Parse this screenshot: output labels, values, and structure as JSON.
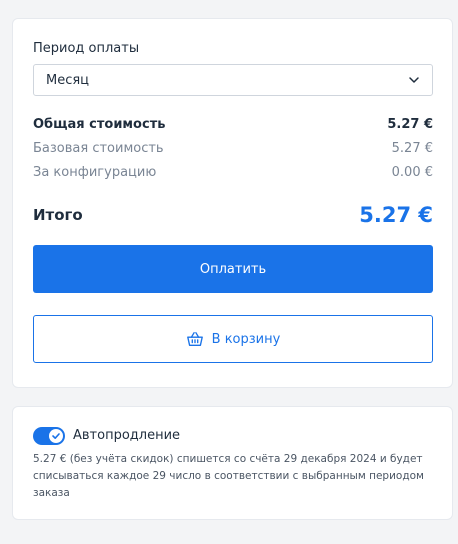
{
  "payment": {
    "period_label": "Период оплаты",
    "period_value": "Месяц",
    "total_cost_label": "Общая стоимость",
    "total_cost_value": "5.27 €",
    "base_cost_label": "Базовая стоимость",
    "base_cost_value": "5.27 €",
    "config_label": "За конфигурацию",
    "config_value": "0.00 €",
    "grand_total_label": "Итого",
    "grand_total_value": "5.27 €",
    "pay_button": "Оплатить",
    "cart_button": "В корзину"
  },
  "autorenew": {
    "enabled": true,
    "label": "Автопродление",
    "description": "5.27 € (без учёта скидок) спишется со счёта 29 декабря 2024 и будет списываться каждое 29 число в соответствии с выбранным периодом заказа"
  },
  "icons": {
    "select_chevron": "chevron-down-icon",
    "cart_icon": "basket-icon",
    "toggle_check": "check-icon"
  },
  "colors": {
    "accent": "#1a73e8",
    "background": "#f3f4f6",
    "card": "#ffffff",
    "text": "#1f2d3d",
    "muted": "#7a8594"
  }
}
